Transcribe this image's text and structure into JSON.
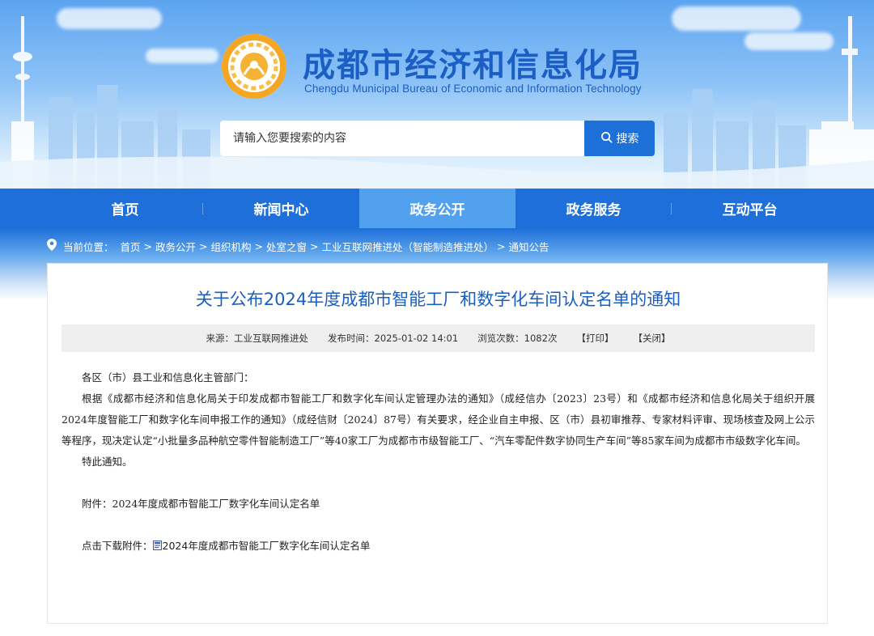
{
  "header": {
    "title": "成都市经济和信息化局",
    "subtitle": "Chengdu Municipal Bureau of Economic and Information Technology",
    "logo_icon": "bureau-emblem-icon",
    "search": {
      "placeholder": "请输入您要搜索的内容",
      "value": "",
      "button_label": "搜索",
      "button_icon": "search-icon"
    }
  },
  "nav": {
    "items": [
      {
        "label": "首页",
        "active": false
      },
      {
        "label": "新闻中心",
        "active": false
      },
      {
        "label": "政务公开",
        "active": true
      },
      {
        "label": "政务服务",
        "active": false
      },
      {
        "label": "互动平台",
        "active": false
      }
    ]
  },
  "breadcrumb": {
    "prefix": "当前位置：",
    "items": [
      "首页",
      "政务公开",
      "组织机构",
      "处室之窗",
      "工业互联网推进处（智能制造推进处）",
      "通知公告"
    ],
    "separator": ">"
  },
  "article": {
    "title": "关于公布2024年度成都市智能工厂和数字化车间认定名单的通知",
    "meta": {
      "source": "来源：工业互联网推进处",
      "published": "发布时间：2025-01-02 14:01",
      "views": "浏览次数：1082次",
      "print_label": "【打印】",
      "close_label": "【关闭】"
    },
    "salutation": "各区（市）县工业和信息化主管部门：",
    "paragraph": "根据《成都市经济和信息化局关于印发成都市智能工厂和数字化车间认定管理办法的通知》（成经信办〔2023〕23号）和《成都市经济和信息化局关于组织开展2024年度智能工厂和数字化车间申报工作的通知》（成经信财〔2024〕87号）有关要求，经企业自主申报、区（市）县初审推荐、专家材料评审、现场核查及网上公示等程序，现决定认定“小批量多品种航空零件智能制造工厂”等40家工厂为成都市市级智能工厂、“汽车零配件数字协同生产车间”等85家车间为成都市市级数字化车间。",
    "closing": "特此通知。",
    "attachment": "附件：2024年度成都市智能工厂数字化车间认定名单",
    "download_prefix": "点击下载附件：",
    "download_link": "2024年度成都市智能工厂数字化车间认定名单"
  },
  "colors": {
    "primary": "#1e6fd9",
    "nav_active": "#52a1ee",
    "title_blue": "#1a5fbf"
  }
}
